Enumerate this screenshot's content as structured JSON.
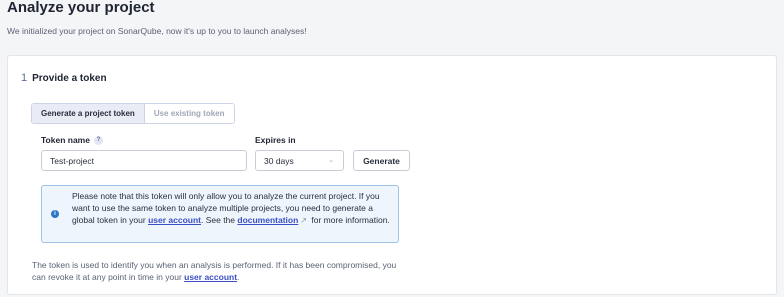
{
  "header": {
    "title": "Analyze your project",
    "subtitle": "We initialized your project on SonarQube, now it's up to you to launch analyses!"
  },
  "step": {
    "number": "1",
    "title": "Provide a token"
  },
  "token_mode": {
    "options": [
      "Generate a project token",
      "Use existing token"
    ],
    "selected": "Generate a project token"
  },
  "form": {
    "token_name_label": "Token name",
    "help_icon": "question-icon",
    "token_name_value": "Test-project",
    "expires_label": "Expires in",
    "expires_value": "30 days",
    "generate_label": "Generate"
  },
  "info": {
    "icon": "info-icon",
    "text_before_link1": "Please note that this token will only allow you to analyze the current project. If you want to use the same token to analyze multiple projects, you need to generate a global token in your ",
    "link1": "user account",
    "text_between": ". See the ",
    "link2": "documentation",
    "external_icon": "external-link-icon",
    "text_after": " for more information."
  },
  "footer": {
    "text_before_link": "The token is used to identify you when an analysis is performed. If it has been compromised, you can revoke it at any point in time in your ",
    "link": "user account",
    "text_after": "."
  },
  "colors": {
    "link": "#3b4fc2",
    "info_bg": "#eef5fc",
    "info_border": "#9ec5e8",
    "info_icon": "#2f75c5"
  }
}
